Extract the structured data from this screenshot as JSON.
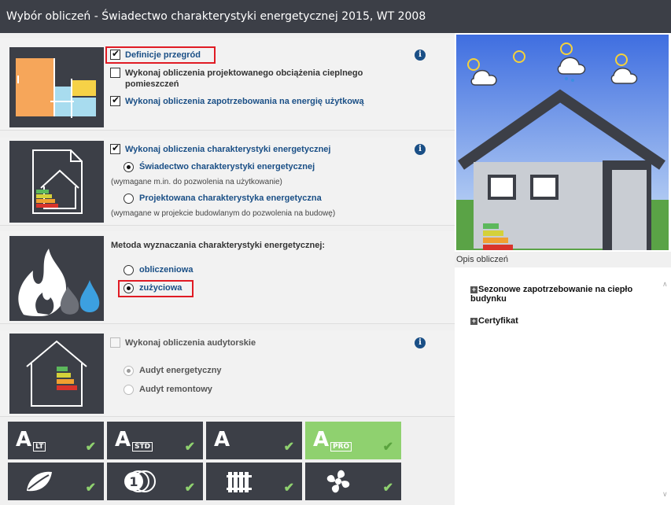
{
  "window": {
    "title": "Wybór obliczeń - Świadectwo charakterystyki energetycznej 2015, WT 2008"
  },
  "section1": {
    "opt_definicje": "Definicje przegród",
    "opt_obciazenie_l1": "Wykonaj obliczenia projektowanego obciążenia cieplnego",
    "opt_obciazenie_l2": "pomieszczeń",
    "opt_zapotrzebowanie": "Wykonaj obliczenia zapotrzebowania na energię użytkową",
    "info": "i"
  },
  "section2": {
    "opt_charakterystyka": "Wykonaj obliczenia charakterystyki energetycznej",
    "radio_swiadectwo": "Świadectwo charakterystyki energetycznej",
    "note_swiadectwo": "(wymagane m.in. do pozwolenia na użytkowanie)",
    "radio_projektowana": "Projektowana charakterystyka energetyczna",
    "note_projektowana": "(wymagane w projekcie budowlanym do pozwolenia na budowę)",
    "info": "i"
  },
  "section3": {
    "heading": "Metoda wyznaczania charakterystyki energetycznej:",
    "radio_obliczeniowa": "obliczeniowa",
    "radio_zuzyciowa": "zużyciowa"
  },
  "section4": {
    "opt_audyt": "Wykonaj obliczenia audytorskie",
    "radio_energetyczny": "Audyt energetyczny",
    "radio_remontowy": "Audyt remontowy",
    "info": "i"
  },
  "modules": {
    "lt": "LT",
    "std": "STD",
    "pro": "PRO",
    "check": "✔"
  },
  "right": {
    "opis_label": "Opis obliczeń",
    "item1": "Sezonowe zapotrzebowanie na ciepło budynku",
    "item2": "Certyfikat"
  },
  "colors": {
    "accent": "#1a4f86",
    "tile": "#3c3f47",
    "active_module": "#8fd16f",
    "highlight": "#e01b24"
  }
}
